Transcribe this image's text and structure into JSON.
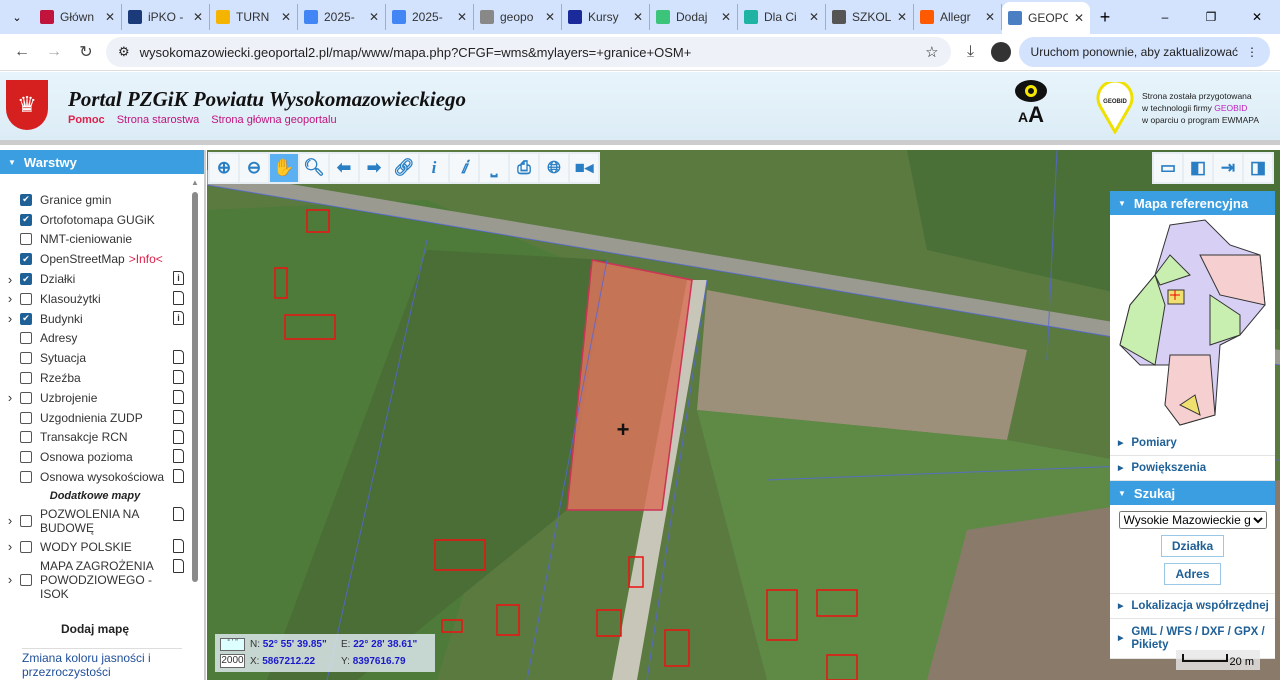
{
  "browser": {
    "tabs": [
      {
        "label": "Główn",
        "color": "#c0143c"
      },
      {
        "label": "iPKO -",
        "color": "#1a3a7a"
      },
      {
        "label": "TURN",
        "color": "#f4b400"
      },
      {
        "label": "2025-",
        "color": "#4285f4"
      },
      {
        "label": "2025-",
        "color": "#4285f4"
      },
      {
        "label": "geopo",
        "color": "#888888"
      },
      {
        "label": "Kursy",
        "color": "#1a2a9a"
      },
      {
        "label": "Dodaj",
        "color": "#3cc47a"
      },
      {
        "label": "Dla Ci",
        "color": "#1fb3a4"
      },
      {
        "label": "SZKOL",
        "color": "#555555"
      },
      {
        "label": "Allegr",
        "color": "#ff5a00"
      },
      {
        "label": "GEOPO",
        "color": "#4a7fc4"
      }
    ],
    "url": "wysokomazowiecki.geoportal2.pl/map/www/mapa.php?CFGF=wms&mylayers=+granice+OSM+",
    "update_button": "Uruchom ponownie, aby zaktualizować"
  },
  "header": {
    "title": "Portal PZGiK Powiatu Wysokomazowieckiego",
    "links": [
      "Pomoc",
      "Strona starostwa",
      "Strona główna geoportalu"
    ],
    "accessibility_text": "AA",
    "geobid_logo": "GEOBID",
    "geobid_lines": [
      "Strona została przygotowana",
      "w technologii firmy ",
      "GEOBID",
      "w oparciu o program EWMAPA"
    ]
  },
  "sidebar": {
    "title": "Warstwy",
    "layers": [
      {
        "label": "Granice gmin",
        "checked": true
      },
      {
        "label": "Ortofotomapa GUGiK",
        "checked": true
      },
      {
        "label": "NMT-cieniowanie",
        "checked": false
      },
      {
        "label": "OpenStreetMap",
        "checked": true,
        "info": ">Info<"
      },
      {
        "label": "Działki",
        "checked": true,
        "expand": true,
        "icon": "info"
      },
      {
        "label": "Klasoużytki",
        "checked": false,
        "expand": true,
        "icon": "doc"
      },
      {
        "label": "Budynki",
        "checked": true,
        "expand": true,
        "icon": "info"
      },
      {
        "label": "Adresy",
        "checked": false
      },
      {
        "label": "Sytuacja",
        "checked": false,
        "icon": "doc"
      },
      {
        "label": "Rzeźba",
        "checked": false,
        "icon": "doc"
      },
      {
        "label": "Uzbrojenie",
        "checked": false,
        "expand": true,
        "icon": "doc"
      },
      {
        "label": "Uzgodnienia ZUDP",
        "checked": false,
        "icon": "doc"
      },
      {
        "label": "Transakcje RCN",
        "checked": false,
        "icon": "doc"
      },
      {
        "label": "Osnowa pozioma",
        "checked": false,
        "icon": "doc"
      },
      {
        "label": "Osnowa wysokościowa",
        "checked": false,
        "icon": "doc"
      }
    ],
    "extra_heading": "Dodatkowe mapy",
    "extra_layers": [
      {
        "label": "POZWOLENIA NA BUDOWĘ",
        "checked": false
      },
      {
        "label": "WODY POLSKIE",
        "checked": false
      },
      {
        "label": "MAPA ZAGROŻENIA POWODZIOWEGO - ISOK",
        "checked": false
      }
    ],
    "add_map": "Dodaj mapę",
    "color_link": "Zmiana koloru jasności i przezroczystości"
  },
  "right_panel": {
    "ref_map": "Mapa referencyjna",
    "items": [
      "Pomiary",
      "Powiększenia"
    ],
    "search": {
      "title": "Szukaj",
      "select_value": "Wysokie Mazowieckie gm.",
      "buttons": [
        "Działka",
        "Adres"
      ]
    },
    "items_after": [
      "Lokalizacja współrzędnej",
      "GML / WFS / DXF / GPX / Pikiety"
    ]
  },
  "coords": {
    "format_btn": "° ' \"",
    "system_btn": "2000",
    "n_label": "N:",
    "n": "52° 55' 39.85\"",
    "e_label": "E:",
    "e": "22° 28' 38.61\"",
    "x_label": "X:",
    "x": "5867212.22",
    "y_label": "Y:",
    "y": "8397616.79"
  },
  "scale": "20 m"
}
